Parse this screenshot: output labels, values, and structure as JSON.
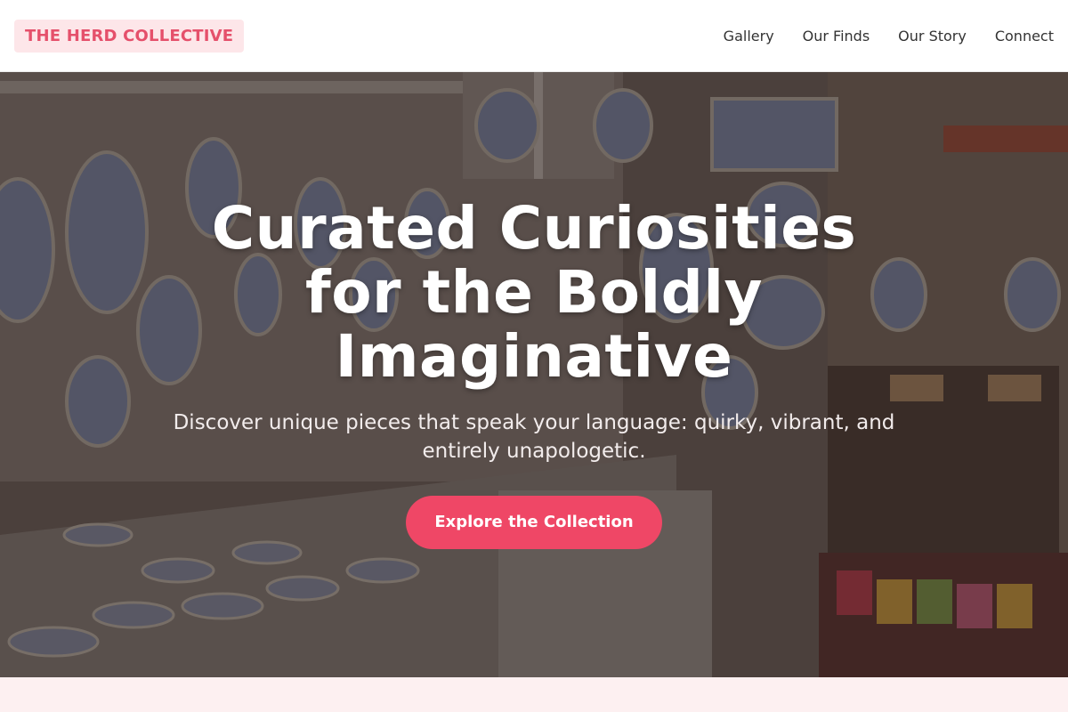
{
  "header": {
    "logo": "THE HERD COLLECTIVE",
    "nav": [
      "Gallery",
      "Our Finds",
      "Our Story",
      "Connect"
    ]
  },
  "hero": {
    "title": "Curated Curiosities for the Boldly Imaginative",
    "subtitle": "Discover unique pieces that speak your language: quirky, vibrant, and entirely unapologetic.",
    "cta_label": "Explore the Collection",
    "background_image": "ceramic-shop-photo"
  },
  "colors": {
    "accent": "#ef4766",
    "logo_text": "#e5506b",
    "logo_bg": "#fde6e9",
    "band": "#fdf0f1"
  }
}
